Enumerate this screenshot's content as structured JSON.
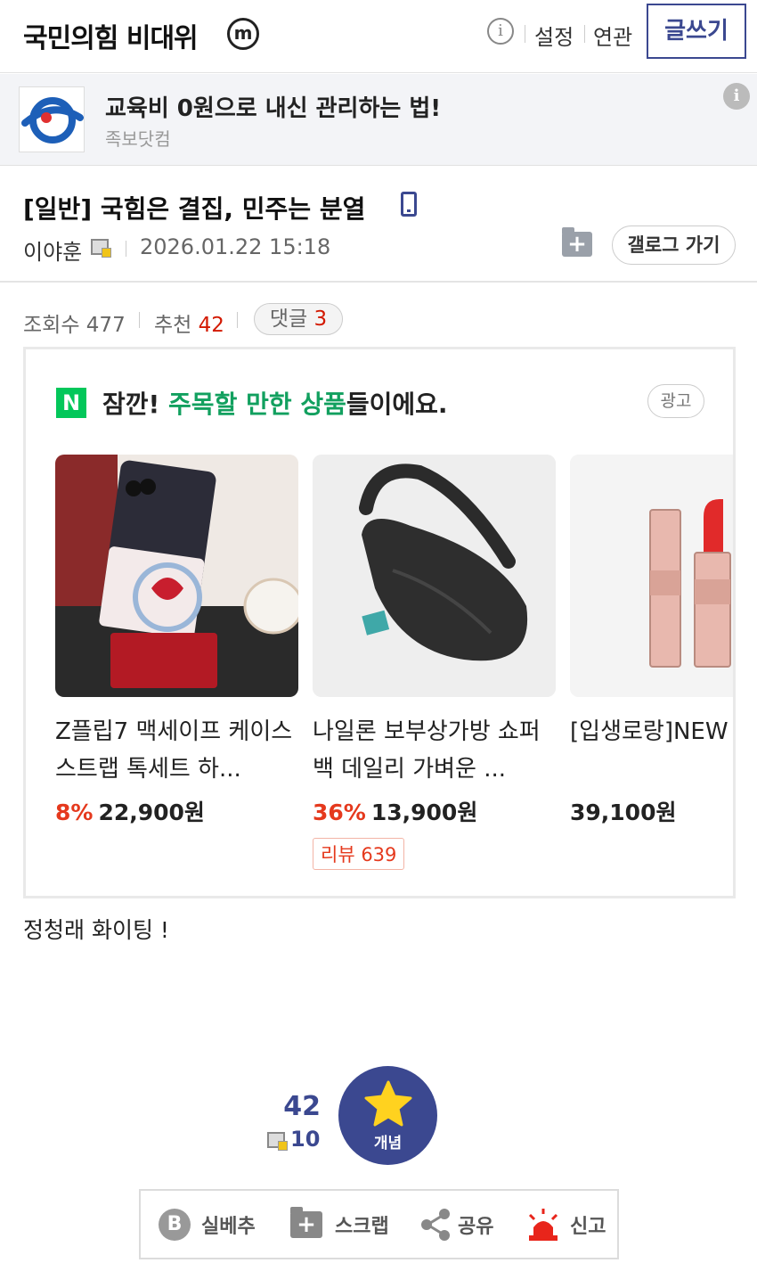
{
  "header": {
    "gallery_title": "국민의힘 비대위",
    "minor_badge": "m",
    "settings_label": "설정",
    "related_label": "연관",
    "write_label": "글쓰기"
  },
  "ad_banner": {
    "title": "교육비 0원으로 내신 관리하는 법!",
    "source": "족보닷컴",
    "info": "i"
  },
  "post": {
    "title": "[일반] 국힘은 결집, 민주는 분열",
    "author": "이야훈",
    "date": "2026.01.22 15:18",
    "gallog_label": "갤로그 가기",
    "body": "정청래 화이팅 !"
  },
  "stats": {
    "views_label": "조회수",
    "views": "477",
    "recommend_label": "추천",
    "recommend": "42",
    "comments_label": "댓글",
    "comments": "3"
  },
  "shopping": {
    "naver_mark": "N",
    "heading_prefix": "잠깐! ",
    "heading_highlight": "주목할 만한 상품",
    "heading_suffix": "들이에요.",
    "ad_tag": "광고",
    "products": [
      {
        "name": "Z플립7 맥세이프 케이스 스트랩 톡세트 하...",
        "discount": "8%",
        "price": "22,900원",
        "review": ""
      },
      {
        "name": "나일론 보부상가방 쇼퍼백 데일리 가벼운 ...",
        "discount": "36%",
        "price": "13,900원",
        "review": "리뷰 639"
      },
      {
        "name": "[입생로랑]NEW 글로우",
        "discount": "",
        "price": "39,100원",
        "review": ""
      }
    ]
  },
  "recommend": {
    "count": "42",
    "fix_count": "10",
    "button_label": "개념"
  },
  "toolbar": {
    "best_label": "실베추",
    "best_mark": "B",
    "scrap_label": "스크랩",
    "share_label": "공유",
    "report_label": "신고"
  },
  "colors": {
    "brand": "#3b4890",
    "red": "#d31900",
    "naver_green": "#03c75a"
  }
}
